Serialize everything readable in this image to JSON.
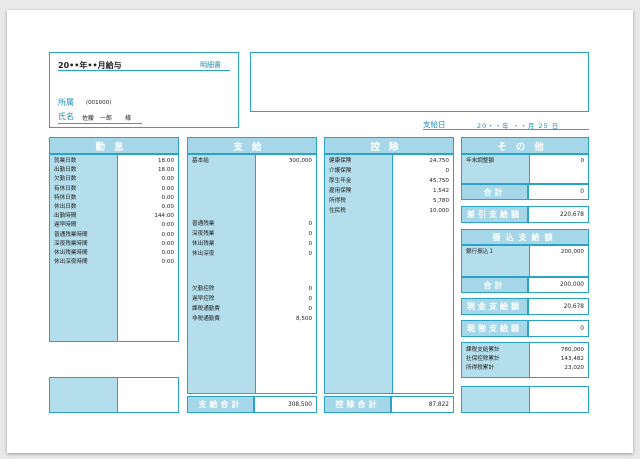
{
  "header": {
    "title": "20••年••月給与",
    "doc_type": "明細書",
    "dept_label": "所属",
    "dept_code": "(001000)",
    "name_label": "氏名",
    "employee_name": "佐藤　一郎",
    "honorific": "様",
    "payday_label": "支給日",
    "payday_value": "20・・年 ・・月 25 日"
  },
  "attendance": {
    "title": "勤怠",
    "items": [
      {
        "label": "就業日数",
        "value": "18.00"
      },
      {
        "label": "出勤日数",
        "value": "18.00"
      },
      {
        "label": "欠勤日数",
        "value": "0.00"
      },
      {
        "label": "有休日数",
        "value": "0.00"
      },
      {
        "label": "特休日数",
        "value": "0.00"
      },
      {
        "label": "休出日数",
        "value": "0.00"
      },
      {
        "label": "出勤時間",
        "value": "144:00"
      },
      {
        "label": "遅早時間",
        "value": "0:00"
      },
      {
        "label": "普通残業時間",
        "value": "0:00"
      },
      {
        "label": "深夜残業時間",
        "value": "0:00"
      },
      {
        "label": "休出残業時間",
        "value": "0:00"
      },
      {
        "label": "休出深夜時間",
        "value": "0:00"
      }
    ]
  },
  "payments": {
    "title": "支給",
    "items_top": [
      {
        "label": "基本給",
        "value": "300,000"
      }
    ],
    "items_mid": [
      {
        "label": "普通残業",
        "value": "0"
      },
      {
        "label": "深夜残業",
        "value": "0"
      },
      {
        "label": "休出残業",
        "value": "0"
      },
      {
        "label": "休出深夜",
        "value": "0"
      }
    ],
    "items_bottom": [
      {
        "label": "欠勤控除",
        "value": "0"
      },
      {
        "label": "遅早控除",
        "value": "0"
      },
      {
        "label": "課税通勤費",
        "value": "0"
      },
      {
        "label": "非税通勤費",
        "value": "8,500"
      }
    ],
    "total_label": "支給合計",
    "total_value": "308,500"
  },
  "deductions": {
    "title": "控除",
    "items": [
      {
        "label": "健康保険",
        "value": "24,750"
      },
      {
        "label": "介護保険",
        "value": "0"
      },
      {
        "label": "厚生年金",
        "value": "45,750"
      },
      {
        "label": "雇用保険",
        "value": "1,542"
      },
      {
        "label": "所得税",
        "value": "5,780"
      },
      {
        "label": "住民税",
        "value": "10,000"
      }
    ],
    "total_label": "控除合計",
    "total_value": "87,822"
  },
  "other": {
    "title": "その他",
    "items": [
      {
        "label": "年末調整額",
        "value": "0"
      }
    ],
    "subtotal_label": "合計",
    "subtotal_value": "0"
  },
  "net_pay": {
    "label": "差引支給額",
    "value": "220,678"
  },
  "transfer": {
    "title": "振込支給額",
    "items": [
      {
        "label": "銀行振込１",
        "value": "200,000"
      }
    ],
    "total_label": "合計",
    "total_value": "200,000"
  },
  "cash_pay": {
    "label": "現金支給額",
    "value": "20,678"
  },
  "inkind_pay": {
    "label": "現物支給額",
    "value": "0"
  },
  "cumulative": {
    "items": [
      {
        "label": "課税支給累計",
        "value": "780,000"
      },
      {
        "label": "社保控除累計",
        "value": "143,482"
      },
      {
        "label": "所得税累計",
        "value": "23,020"
      }
    ]
  }
}
